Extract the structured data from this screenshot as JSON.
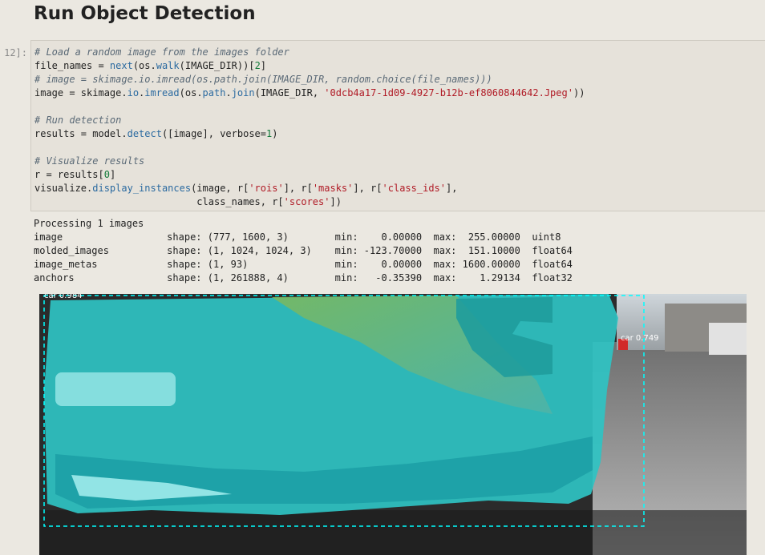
{
  "heading": "Run Object Detection",
  "cell_prompt": "12]:",
  "code": {
    "comment_load": "# Load a random image from the images folder",
    "line_file_names_a": "file_names = ",
    "line_file_names_b": "next",
    "line_file_names_c": "(os.",
    "line_file_names_d": "walk",
    "line_file_names_e": "(IMAGE_DIR))[",
    "line_file_names_f": "2",
    "line_file_names_g": "]",
    "comment_choice": "# image = skimage.io.imread(os.path.join(IMAGE_DIR, random.choice(file_names)))",
    "line_image_a": "image = skimage.",
    "line_image_b": "io",
    "line_image_c": ".",
    "line_image_d": "imread",
    "line_image_e": "(os.",
    "line_image_f": "path",
    "line_image_g": ".",
    "line_image_h": "join",
    "line_image_i": "(IMAGE_DIR, ",
    "line_image_j": "'0dcb4a17-1d09-4927-b12b-ef8060844642.Jpeg'",
    "line_image_k": "))",
    "comment_run": "# Run detection",
    "line_results_a": "results = model.",
    "line_results_b": "detect",
    "line_results_c": "([image], verbose=",
    "line_results_d": "1",
    "line_results_e": ")",
    "comment_vis": "# Visualize results",
    "line_r_a": "r = results[",
    "line_r_b": "0",
    "line_r_c": "]",
    "line_vis_a": "visualize.",
    "line_vis_b": "display_instances",
    "line_vis_c": "(image, r[",
    "line_vis_d": "'rois'",
    "line_vis_e": "], r[",
    "line_vis_f": "'masks'",
    "line_vis_g": "], r[",
    "line_vis_h": "'class_ids'",
    "line_vis_i": "],",
    "line_vis2_a": "                            class_names, r[",
    "line_vis2_b": "'scores'",
    "line_vis2_c": "])"
  },
  "output": {
    "processing": "Processing 1 images",
    "rows": [
      "image                  shape: (777, 1600, 3)        min:    0.00000  max:  255.00000  uint8",
      "molded_images          shape: (1, 1024, 1024, 3)    min: -123.70000  max:  151.10000  float64",
      "image_metas            shape: (1, 93)               min:    0.00000  max: 1600.00000  float64",
      "anchors                shape: (1, 261888, 4)        min:   -0.35390  max:    1.29134  float32"
    ]
  },
  "detections": [
    {
      "label": "car 0.984",
      "color": "#00ffff"
    },
    {
      "label": "car 0.749",
      "color": "#d12a2a"
    }
  ]
}
